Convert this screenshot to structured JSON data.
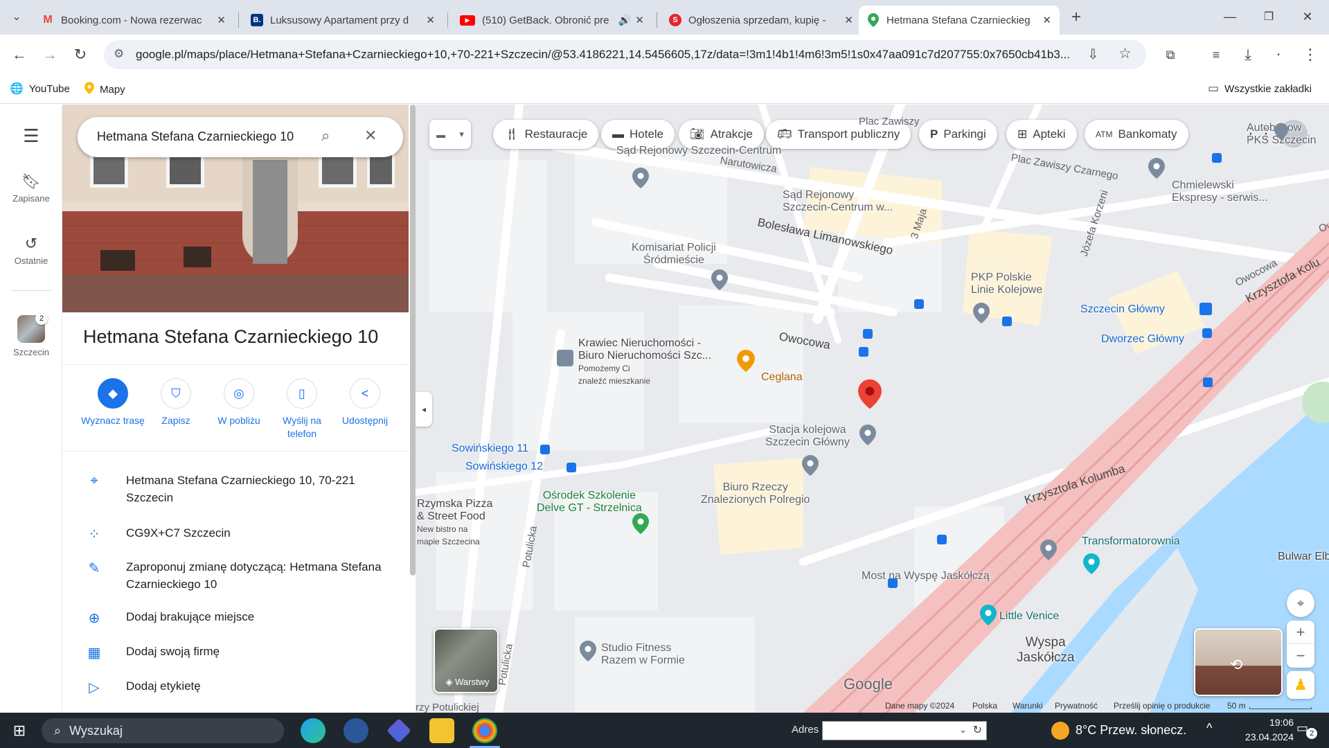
{
  "browser": {
    "tabs": [
      {
        "title": "Booking.com - Nowa rezerwac",
        "icon": "gmail-icon"
      },
      {
        "title": "Luksusowy Apartament przy d",
        "icon": "booking-icon"
      },
      {
        "title": "(510) GetBack. Obronić pre",
        "icon": "youtube-icon"
      },
      {
        "title": "Ogłoszenia sprzedam, kupię -",
        "icon": "olx-icon"
      },
      {
        "title": "Hetmana Stefana Czarnieckieg",
        "icon": "maps-icon"
      }
    ],
    "url": "google.pl/maps/place/Hetmana+Stefana+Czarnieckiego+10,+70-221+Szczecin/@53.4186221,14.5456605,17z/data=!3m1!4b1!4m6!3m5!1s0x47aa091c7d207755:0x7650cb41b3...",
    "bookmarks": [
      "YouTube",
      "Mapy"
    ],
    "all_bookmarks": "Wszystkie zakładki"
  },
  "rail": {
    "saved": "Zapisane",
    "recent": "Ostatnie",
    "city": "Szczecin",
    "city_badge": "2"
  },
  "panel": {
    "search_query": "Hetmana Stefana Czarnieckiego 10",
    "title": "Hetmana Stefana Czarnieckiego 10",
    "actions": [
      {
        "label": "Wyznacz trasę"
      },
      {
        "label": "Zapisz"
      },
      {
        "label": "W pobliżu"
      },
      {
        "label": "Wyślij na telefon"
      },
      {
        "label": "Udostępnij"
      }
    ],
    "info": [
      "Hetmana Stefana Czarnieckiego 10, 70-221 Szczecin",
      "CG9X+C7 Szczecin",
      "Zaproponuj zmianę dotyczącą: Hetmana Stefana Czarnieckiego 10",
      "Dodaj brakujące miejsce",
      "Dodaj swoją firmę",
      "Dodaj etykietę"
    ]
  },
  "map": {
    "chips": [
      "Restauracje",
      "Hotele",
      "Atrakcje",
      "Transport publiczny",
      "Parkingi",
      "Apteki",
      "Bankomaty"
    ],
    "places": {
      "sad1": "Sąd Rejonowy Szczecin-Centrum",
      "sad2a": "Sąd Rejonowy",
      "sad2b": "Szczecin-Centrum w...",
      "komisariat_a": "Komisariat Policji",
      "komisariat_b": "Śródmieście",
      "pkp_a": "PKP Polskie",
      "pkp_b": "Linie Kolejowe",
      "krawiec_a": "Krawiec Nieruchomości -",
      "krawiec_b": "Biuro Nieruchomości Szc...",
      "krawiec_c": "Pomożemy Ci",
      "krawiec_d": "znaleźć mieszkanie",
      "ceglana": "Ceglana",
      "stacja_a": "Stacja kolejowa",
      "stacja_b": "Szczecin Główny",
      "szcz_glowny": "Szczecin Główny",
      "dworzec": "Dworzec Główny",
      "autobus_a": "Autobusow",
      "autobus_b": "PKS Szczecin",
      "chmielewski_a": "Chmielewski",
      "chmielewski_b": "Ekspresy - serwis...",
      "sow11": "Sowińskiego 11",
      "sow12": "Sowińskiego 12",
      "osrodek_a": "Ośrodek Szkolenie",
      "osrodek_b": "Delve GT - Strzelnica",
      "biuro_a": "Biuro Rzeczy",
      "biuro_b": "Znalezionych Polregio",
      "pizza_a": "Rzymska Pizza",
      "pizza_b": "& Street Food",
      "pizza_c": "New bistro na",
      "pizza_d": "mapie Szczecina",
      "transformatorownia": "Transformatorownia",
      "most": "Most na Wyspę Jaskółczą",
      "little_venice": "Little Venice",
      "wyspa_a": "Wyspa",
      "wyspa_b": "Jaskółcza",
      "studio_a": "Studio Fitness",
      "studio_b": "Razem w Formie",
      "bulwar": "Bulwar Elbl"
    },
    "streets": {
      "narutowicza": "Narutowicza",
      "limanowskiego": "Bolesława Limanowskiego",
      "owocowa1": "Owocowa",
      "owocowa2": "Owocowa",
      "owocowa3": "Owocowa",
      "trzeciego_maja": "3 Maja",
      "korzeniowskiego": "Józefa Korzeni",
      "placzawiszy": "Plac Zawiszy",
      "zawiszy_czarnego": "Plac Zawiszy Czarnego",
      "krzysztofa1": "Krzysztofa Kolumba",
      "krzysztofa2": "Krzysztofa Kolu",
      "potulicka1": "Potulicka",
      "potulicka2": "Potulicka",
      "potulicka3": "rzy Potulickiej"
    },
    "layers": "Warstwy",
    "google": "Google",
    "footer": [
      "Dane mapy ©2024",
      "Polska",
      "Warunki",
      "Prywatność",
      "Prześlij opinię o produkcie",
      "50 m"
    ]
  },
  "taskbar": {
    "search": "Wyszukaj",
    "adres": "Adres",
    "weather": "8°C  Przew. słonecz.",
    "time": "19:06",
    "date": "23.04.2024",
    "notif": "2"
  }
}
